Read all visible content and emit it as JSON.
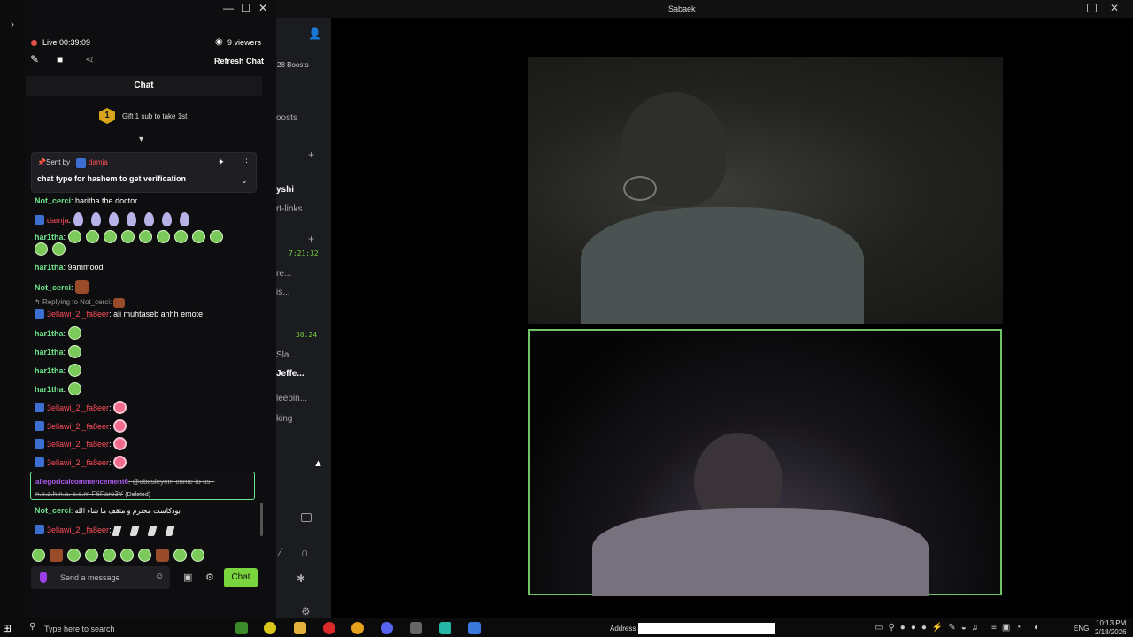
{
  "titlebar": {
    "username": "Sabaek"
  },
  "chat_window": {
    "status": "Live",
    "timer": "00:39:09",
    "viewers": "9 viewers",
    "refresh_label": "Refresh Chat",
    "header": "Chat",
    "gift": {
      "rank": "1",
      "text": "Gift 1 sub to take 1st"
    },
    "pinned": {
      "sent_by": "Sent by",
      "author": "damja",
      "message": "chat type for hashem to get verification"
    },
    "messages": [
      {
        "user": "Not_cerci",
        "text": ": haritha the doctor"
      },
      {
        "user": "damja",
        "text": ":"
      },
      {
        "user": "har1tha",
        "text": ":"
      },
      {
        "user": "har1tha",
        "text": ": 9ammoodi"
      },
      {
        "user": "Not_cerci",
        "text": ":"
      },
      {
        "reply": "Replying to Not_cerci:"
      },
      {
        "user": "3ellawi_2l_fa8eer",
        "text": ": ali muhtaseb ahhh emote"
      },
      {
        "user": "har1tha",
        "text": ":"
      },
      {
        "user": "har1tha",
        "text": ":"
      },
      {
        "user": "har1tha",
        "text": ":"
      },
      {
        "user": "har1tha",
        "text": ":"
      },
      {
        "user": "3ellawi_2l_fa8eer",
        "text": ":"
      },
      {
        "user": "3ellawi_2l_fa8eer",
        "text": ":"
      },
      {
        "user": "3ellawi_2l_fa8eer",
        "text": ":"
      },
      {
        "user": "3ellawi_2l_fa8eer",
        "text": ":"
      }
    ],
    "deleted": {
      "user": "allegoricalcommencement6",
      "text": ": @abosleyem come to us - n.e.z.h.n.a. c.o.m F6Faro3Y",
      "tag": "(Deleted)"
    },
    "arabic_line": {
      "user": "Not_cerci",
      "text": ": بودكاست محترم و مثقف ما شاء الله"
    },
    "last_line": {
      "user": "3ellawi_2l_fa8eer",
      "text": ":"
    },
    "input_placeholder": "Send a message",
    "send_label": "Chat"
  },
  "background_app": {
    "boosts_badge": "28 Boosts",
    "boosts_text": "oosts",
    "channel": "yshi",
    "links": "rt-links",
    "time1": "7:21:32",
    "time2": "30:24",
    "items": [
      "re...",
      "is...",
      "Sla...",
      "Jeffe...",
      "leepin...",
      "king"
    ]
  },
  "taskbar": {
    "search_placeholder": "Type here to search",
    "address_label": "Address",
    "lang": "ENG",
    "time": "10:13 PM",
    "date": "2/18/2026"
  },
  "colors": {
    "accent": "#7ad43e",
    "username_green": "#6ee68d",
    "username_red": "#ff4d5a",
    "live_dot": "#e0524a"
  }
}
